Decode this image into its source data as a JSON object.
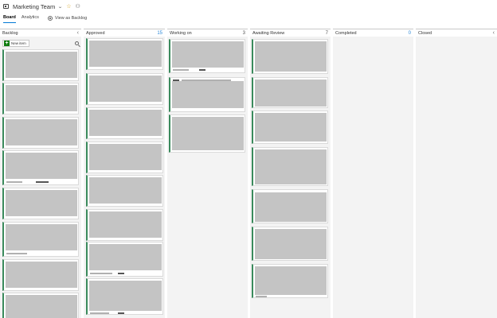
{
  "header": {
    "team_name": "Marketing Team",
    "team_icon": "board-icon",
    "chevron": "chevron-down-icon",
    "favorite_icon": "star-icon",
    "members_icon": "people-icon"
  },
  "tabs": {
    "board": "Board",
    "analytics": "Analytics",
    "view_as_backlog": "View as Backlog"
  },
  "columns": {
    "backlog": {
      "title": "Backlog",
      "count": "",
      "new_item": "New item"
    },
    "approved": {
      "title": "Approved",
      "count": "15"
    },
    "working": {
      "title": "Working on",
      "count": "3"
    },
    "review": {
      "title": "Awaiting Review",
      "count": "7"
    },
    "completed": {
      "title": "Completed",
      "count": "0"
    },
    "closed": {
      "title": "Closed",
      "count": ""
    }
  },
  "colors": {
    "card_accent": "#3a8a5c",
    "active_tab": "#0078d4",
    "new_item_button": "#107c10",
    "favorite": "#d4a017"
  }
}
